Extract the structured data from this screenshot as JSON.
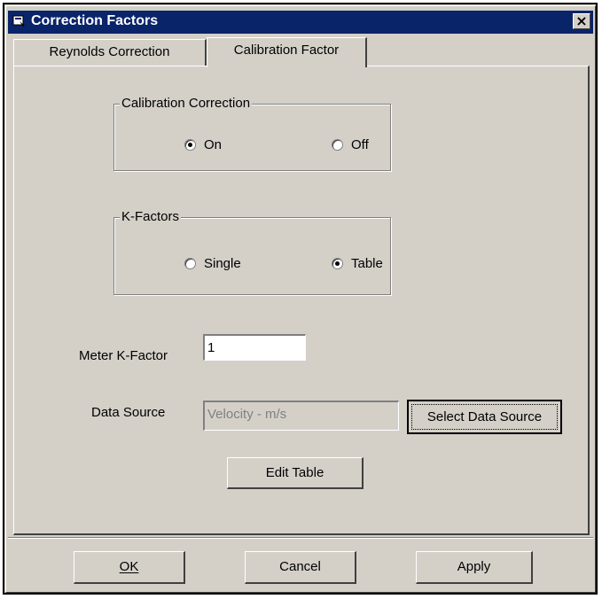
{
  "window": {
    "title": "Correction Factors",
    "close_glyph": "×"
  },
  "tabs": [
    {
      "label": "Reynolds Correction"
    },
    {
      "label": "Calibration Factor"
    }
  ],
  "calibration_group": {
    "label": "Calibration Correction",
    "options": [
      {
        "label": "On",
        "checked": true
      },
      {
        "label": "Off",
        "checked": false
      }
    ]
  },
  "kfactors_group": {
    "label": "K-Factors",
    "options": [
      {
        "label": "Single",
        "checked": false
      },
      {
        "label": "Table",
        "checked": true
      }
    ]
  },
  "meter_kfactor": {
    "label": "Meter K-Factor",
    "value": "1"
  },
  "data_source": {
    "label": "Data Source",
    "value": "Velocity - m/s",
    "button": "Select Data Source"
  },
  "edit_table_button": "Edit Table",
  "footer": {
    "ok_label": "OK",
    "cancel_label": "Cancel",
    "apply_label": "Apply"
  },
  "colors": {
    "face": "#d4d0c8",
    "titlebar": "#0a246a",
    "disabled_text": "#808080"
  }
}
